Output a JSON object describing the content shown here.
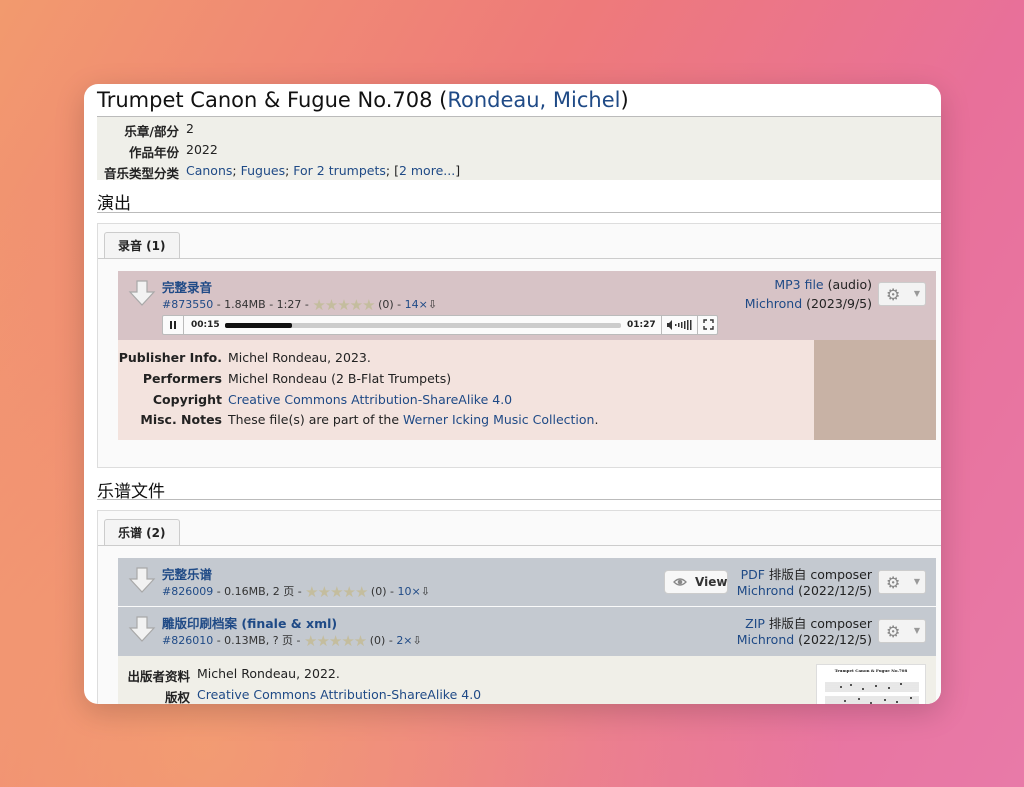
{
  "page": {
    "title": "Trumpet Canon & Fugue No.708",
    "composer": "Rondeau, Michel"
  },
  "info": [
    {
      "key": "乐章/部分",
      "value": "2"
    },
    {
      "key": "作品年份",
      "value": "2022"
    }
  ],
  "genre": {
    "key": "音乐类型分类",
    "links": [
      "Canons",
      "Fugues",
      "For 2 trumpets"
    ],
    "more": "2 more..."
  },
  "performances": {
    "section_title": "演出",
    "tab_label": "录音 (1)",
    "file": {
      "name": "完整录音",
      "id": "#873550",
      "meta": " - 1.84MB - 1:27 - ",
      "rating_count": "(0) - ",
      "downloads": "14×",
      "format_link": "MP3 file",
      "format_extra": " (audio)",
      "uploader": "Michrond",
      "date": " (2023/9/5)"
    },
    "player": {
      "current_time": "00:15",
      "duration": "01:27",
      "progress": 0.17
    },
    "details": {
      "publisher_label": "Publisher Info.",
      "publisher_value": "Michel Rondeau, 2023.",
      "performers_label": "Performers",
      "performers_value": "Michel Rondeau (2 B-Flat Trumpets)",
      "copyright_label": "Copyright",
      "copyright_value": "Creative Commons Attribution-ShareAlike 4.0",
      "notes_label": "Misc. Notes",
      "notes_prefix": "These file(s) are part of the ",
      "notes_link": "Werner Icking Music Collection",
      "notes_suffix": "."
    }
  },
  "scores": {
    "section_title": "乐谱文件",
    "tab_label": "乐谱 (2)",
    "files": [
      {
        "name": "完整乐谱",
        "id": "#826009",
        "meta": " - 0.16MB, 2 页 - ",
        "rating_count": "(0) - ",
        "downloads": "10×",
        "view_label": "View",
        "format_link": "PDF",
        "format_extra": " 排版自 composer",
        "uploader": "Michrond",
        "date": " (2022/12/5)"
      },
      {
        "name": "雕版印刷档案 (finale & xml)",
        "id": "#826010",
        "meta": " - 0.13MB, ? 页 - ",
        "rating_count": "(0) - ",
        "downloads": "2×",
        "format_link": "ZIP",
        "format_extra": " 排版自 composer",
        "uploader": "Michrond",
        "date": " (2022/12/5)"
      }
    ],
    "details": {
      "publisher_label": "出版者资料",
      "publisher_value": "Michel Rondeau, 2022.",
      "copyright_label": "版权",
      "copyright_value": "Creative Commons Attribution-ShareAlike 4.0",
      "thumb_title": "Trumpet Canon & Fugue No.708"
    }
  },
  "icons": {
    "download": "download-arrow-icon",
    "gear": "gear-icon",
    "eye": "eye-icon"
  },
  "colors": {
    "link": "#1f4a86",
    "audio_row": "#d7c3c6",
    "score_row": "#c4c9d0"
  }
}
